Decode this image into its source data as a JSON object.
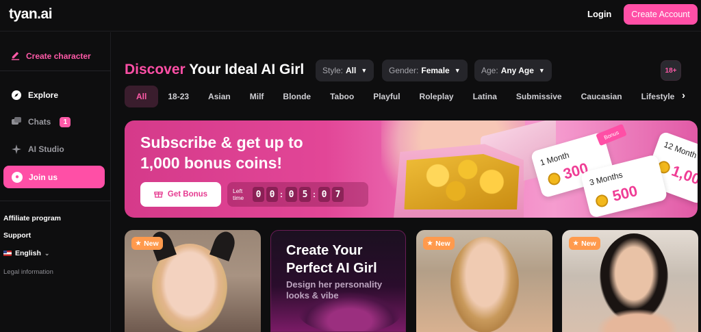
{
  "header": {
    "logo": "tyan.ai",
    "login": "Login",
    "create_account": "Create Account"
  },
  "sidebar": {
    "create_character": "Create character",
    "items": [
      {
        "label": "Explore",
        "icon": "compass-icon"
      },
      {
        "label": "Chats",
        "icon": "chat-icon",
        "badge": "1"
      },
      {
        "label": "AI Studio",
        "icon": "sparkle-icon"
      }
    ],
    "join_us": "Join us",
    "affiliate": "Affiliate program",
    "support": "Support",
    "language": "English",
    "legal": "Legal information"
  },
  "main": {
    "headline_accent": "Discover",
    "headline_rest": "Your Ideal AI Girl",
    "filters": {
      "style_label": "Style:",
      "style_value": "All",
      "gender_label": "Gender:",
      "gender_value": "Female",
      "age_label": "Age:",
      "age_value": "Any Age"
    },
    "age_badge": "18+",
    "tabs": [
      "All",
      "18-23",
      "Asian",
      "Milf",
      "Blonde",
      "Taboo",
      "Playful",
      "Roleplay",
      "Latina",
      "Submissive",
      "Caucasian",
      "Lifestyle"
    ]
  },
  "banner": {
    "title_line1": "Subscribe & get up to",
    "title_line2": "1,000 bonus coins!",
    "button": "Get Bonus",
    "timer_label_1": "Left",
    "timer_label_2": "time",
    "digits": [
      "0",
      "0",
      "0",
      "5",
      "0",
      "7"
    ],
    "offers": [
      {
        "label": "1 Month",
        "amount": "300"
      },
      {
        "label": "3 Months",
        "amount": "500"
      },
      {
        "label": "12 Month",
        "amount": "1,00"
      }
    ],
    "bonus_tag": "Bonus"
  },
  "cards": {
    "new_label": "New",
    "promo_title_1": "Create Your",
    "promo_title_2": "Perfect AI Girl",
    "promo_sub_1": "Design her personality",
    "promo_sub_2": "looks & vibe"
  },
  "colors": {
    "accent": "#ff4fa6",
    "background": "#0e0e0f",
    "new_badge": "#ff9a4d"
  }
}
